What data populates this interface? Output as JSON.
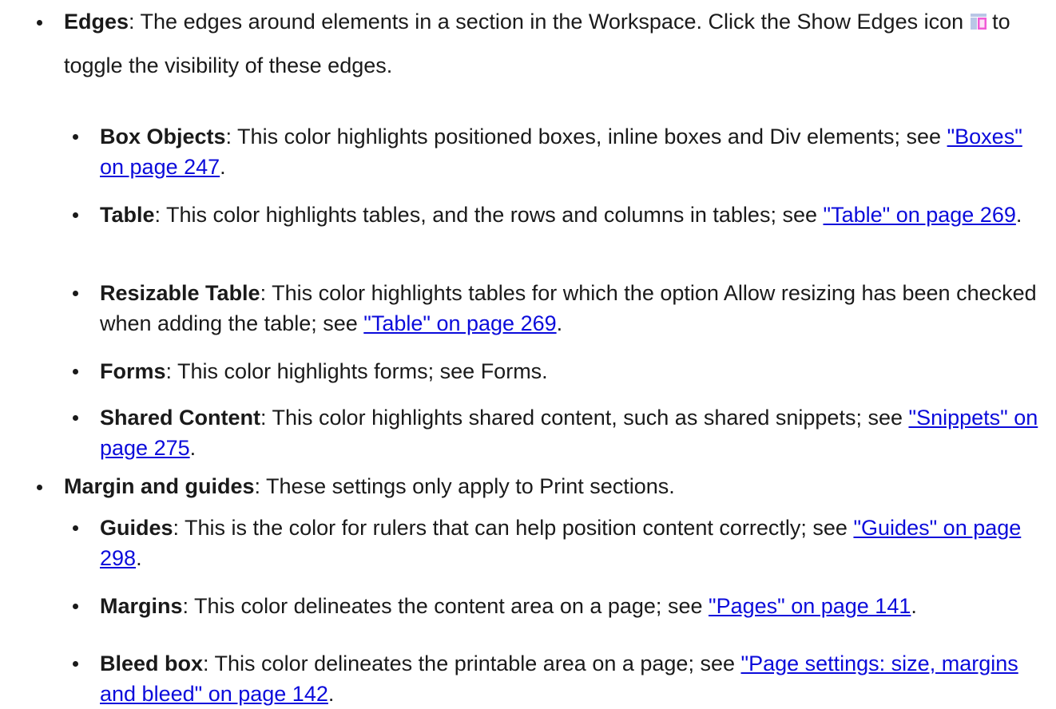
{
  "edges": {
    "term": "Edges",
    "text_before_icon": ": The edges around elements in a section in the Workspace. Click the Show Edges icon",
    "text_after_icon": "to toggle the visibility of these edges.",
    "icon": "show-edges-icon",
    "items": [
      {
        "term": "Box Objects",
        "text": ": This color highlights positioned boxes, inline boxes and Div elements; see ",
        "link": "\"Boxes\" on page 247",
        "tail": "."
      },
      {
        "term": "Table",
        "text": ": This color highlights tables, and the rows and columns in tables; see ",
        "link": "\"Table\" on page 269",
        "tail": "."
      },
      {
        "term": "Resizable Table",
        "text": ": This color highlights tables for which the option Allow resizing has been checked when adding the table; see ",
        "link": "\"Table\" on page 269",
        "tail": "."
      },
      {
        "term": "Forms",
        "text": ": This color highlights forms; see Forms."
      },
      {
        "term": "Shared Content",
        "text": ": This color highlights shared content, such as shared snippets; see ",
        "link": "\"Snippets\" on page 275",
        "tail": "."
      }
    ]
  },
  "margins": {
    "term": "Margin and guides",
    "text": ": These settings only apply to Print sections.",
    "items": [
      {
        "term": "Guides",
        "text": ": This is the color for rulers that can help position content correctly; see ",
        "link": "\"Guides\" on page 298",
        "tail": "."
      },
      {
        "term": "Margins",
        "text": ": This color delineates the content area on a page; see ",
        "link": "\"Pages\" on page 141",
        "tail": "."
      },
      {
        "term": "Bleed box",
        "text": ": This color delineates the printable area on a page; see ",
        "link": "\"Page settings: size, margins and bleed\" on page 142",
        "tail": "."
      }
    ]
  },
  "colors": {
    "link": "#0b0bdb",
    "text": "#1a1a1a"
  }
}
